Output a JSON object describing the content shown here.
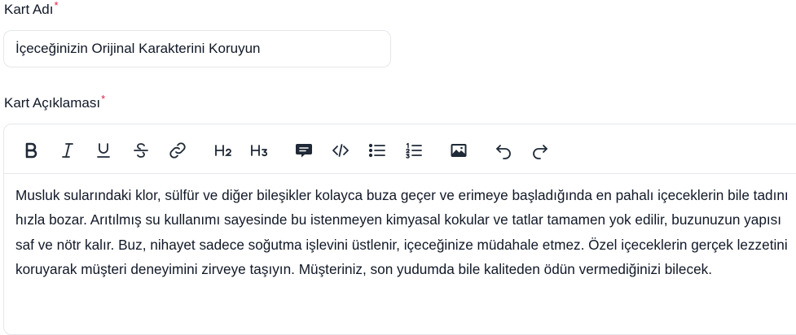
{
  "card_name": {
    "label": "Kart Adı",
    "required_mark": "*",
    "value": "İçeceğinizin Orijinal Karakterini Koruyun"
  },
  "card_description": {
    "label": "Kart Açıklaması",
    "required_mark": "*",
    "toolbar": [
      {
        "name": "bold-button",
        "icon": "bold-icon"
      },
      {
        "name": "italic-button",
        "icon": "italic-icon"
      },
      {
        "name": "underline-button",
        "icon": "underline-icon"
      },
      {
        "name": "strikethrough-button",
        "icon": "strikethrough-icon"
      },
      {
        "name": "link-button",
        "icon": "link-icon"
      },
      {
        "name": "heading2-button",
        "icon": "heading-2-icon",
        "label": "H2"
      },
      {
        "name": "heading3-button",
        "icon": "heading-3-icon",
        "label": "H3"
      },
      {
        "name": "comment-button",
        "icon": "comment-icon"
      },
      {
        "name": "code-button",
        "icon": "code-icon"
      },
      {
        "name": "bullet-list-button",
        "icon": "bullet-list-icon"
      },
      {
        "name": "numbered-list-button",
        "icon": "numbered-list-icon"
      },
      {
        "name": "image-button",
        "icon": "image-icon"
      },
      {
        "name": "undo-button",
        "icon": "undo-icon"
      },
      {
        "name": "redo-button",
        "icon": "redo-icon"
      }
    ],
    "content": "Musluk sularındaki klor, sülfür ve diğer bileşikler kolayca buza geçer ve erimeye başladığında en pahalı içeceklerin bile tadını hızla bozar. Arıtılmış su kullanımı sayesinde bu istenmeyen kimyasal kokular ve tatlar tamamen yok edilir, buzunuzun yapısı saf ve nötr kalır. Buz, nihayet sadece soğutma işlevini üstlenir, içeceğinize müdahale etmez. Özel içeceklerin gerçek lezzetini koruyarak müşteri deneyimini zirveye taşıyın. Müşteriniz, son yudumda bile kaliteden ödün vermediğinizi bilecek."
  }
}
